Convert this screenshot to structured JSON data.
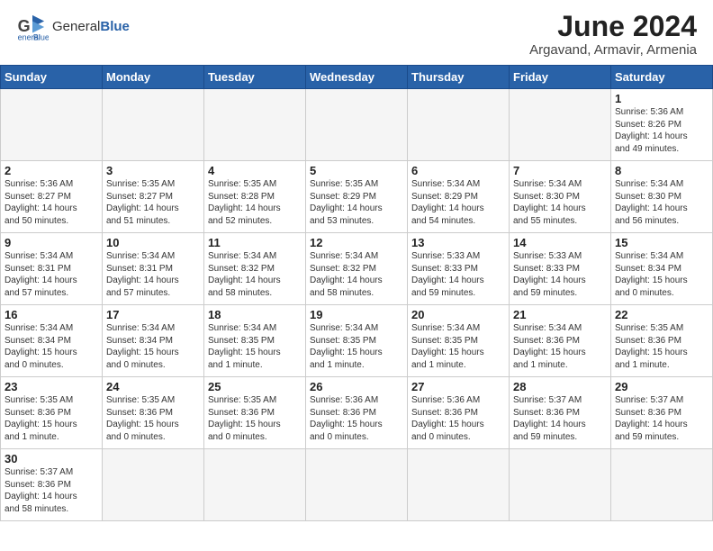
{
  "header": {
    "logo_general": "General",
    "logo_blue": "Blue",
    "month": "June 2024",
    "location": "Argavand, Armavir, Armenia"
  },
  "weekdays": [
    "Sunday",
    "Monday",
    "Tuesday",
    "Wednesday",
    "Thursday",
    "Friday",
    "Saturday"
  ],
  "weeks": [
    [
      {
        "day": "",
        "info": ""
      },
      {
        "day": "",
        "info": ""
      },
      {
        "day": "",
        "info": ""
      },
      {
        "day": "",
        "info": ""
      },
      {
        "day": "",
        "info": ""
      },
      {
        "day": "",
        "info": ""
      },
      {
        "day": "1",
        "info": "Sunrise: 5:36 AM\nSunset: 8:26 PM\nDaylight: 14 hours\nand 49 minutes."
      }
    ],
    [
      {
        "day": "2",
        "info": "Sunrise: 5:36 AM\nSunset: 8:27 PM\nDaylight: 14 hours\nand 50 minutes."
      },
      {
        "day": "3",
        "info": "Sunrise: 5:35 AM\nSunset: 8:27 PM\nDaylight: 14 hours\nand 51 minutes."
      },
      {
        "day": "4",
        "info": "Sunrise: 5:35 AM\nSunset: 8:28 PM\nDaylight: 14 hours\nand 52 minutes."
      },
      {
        "day": "5",
        "info": "Sunrise: 5:35 AM\nSunset: 8:29 PM\nDaylight: 14 hours\nand 53 minutes."
      },
      {
        "day": "6",
        "info": "Sunrise: 5:34 AM\nSunset: 8:29 PM\nDaylight: 14 hours\nand 54 minutes."
      },
      {
        "day": "7",
        "info": "Sunrise: 5:34 AM\nSunset: 8:30 PM\nDaylight: 14 hours\nand 55 minutes."
      },
      {
        "day": "8",
        "info": "Sunrise: 5:34 AM\nSunset: 8:30 PM\nDaylight: 14 hours\nand 56 minutes."
      }
    ],
    [
      {
        "day": "9",
        "info": "Sunrise: 5:34 AM\nSunset: 8:31 PM\nDaylight: 14 hours\nand 57 minutes."
      },
      {
        "day": "10",
        "info": "Sunrise: 5:34 AM\nSunset: 8:31 PM\nDaylight: 14 hours\nand 57 minutes."
      },
      {
        "day": "11",
        "info": "Sunrise: 5:34 AM\nSunset: 8:32 PM\nDaylight: 14 hours\nand 58 minutes."
      },
      {
        "day": "12",
        "info": "Sunrise: 5:34 AM\nSunset: 8:32 PM\nDaylight: 14 hours\nand 58 minutes."
      },
      {
        "day": "13",
        "info": "Sunrise: 5:33 AM\nSunset: 8:33 PM\nDaylight: 14 hours\nand 59 minutes."
      },
      {
        "day": "14",
        "info": "Sunrise: 5:33 AM\nSunset: 8:33 PM\nDaylight: 14 hours\nand 59 minutes."
      },
      {
        "day": "15",
        "info": "Sunrise: 5:34 AM\nSunset: 8:34 PM\nDaylight: 15 hours\nand 0 minutes."
      }
    ],
    [
      {
        "day": "16",
        "info": "Sunrise: 5:34 AM\nSunset: 8:34 PM\nDaylight: 15 hours\nand 0 minutes."
      },
      {
        "day": "17",
        "info": "Sunrise: 5:34 AM\nSunset: 8:34 PM\nDaylight: 15 hours\nand 0 minutes."
      },
      {
        "day": "18",
        "info": "Sunrise: 5:34 AM\nSunset: 8:35 PM\nDaylight: 15 hours\nand 1 minute."
      },
      {
        "day": "19",
        "info": "Sunrise: 5:34 AM\nSunset: 8:35 PM\nDaylight: 15 hours\nand 1 minute."
      },
      {
        "day": "20",
        "info": "Sunrise: 5:34 AM\nSunset: 8:35 PM\nDaylight: 15 hours\nand 1 minute."
      },
      {
        "day": "21",
        "info": "Sunrise: 5:34 AM\nSunset: 8:36 PM\nDaylight: 15 hours\nand 1 minute."
      },
      {
        "day": "22",
        "info": "Sunrise: 5:35 AM\nSunset: 8:36 PM\nDaylight: 15 hours\nand 1 minute."
      }
    ],
    [
      {
        "day": "23",
        "info": "Sunrise: 5:35 AM\nSunset: 8:36 PM\nDaylight: 15 hours\nand 1 minute."
      },
      {
        "day": "24",
        "info": "Sunrise: 5:35 AM\nSunset: 8:36 PM\nDaylight: 15 hours\nand 0 minutes."
      },
      {
        "day": "25",
        "info": "Sunrise: 5:35 AM\nSunset: 8:36 PM\nDaylight: 15 hours\nand 0 minutes."
      },
      {
        "day": "26",
        "info": "Sunrise: 5:36 AM\nSunset: 8:36 PM\nDaylight: 15 hours\nand 0 minutes."
      },
      {
        "day": "27",
        "info": "Sunrise: 5:36 AM\nSunset: 8:36 PM\nDaylight: 15 hours\nand 0 minutes."
      },
      {
        "day": "28",
        "info": "Sunrise: 5:37 AM\nSunset: 8:36 PM\nDaylight: 14 hours\nand 59 minutes."
      },
      {
        "day": "29",
        "info": "Sunrise: 5:37 AM\nSunset: 8:36 PM\nDaylight: 14 hours\nand 59 minutes."
      }
    ],
    [
      {
        "day": "30",
        "info": "Sunrise: 5:37 AM\nSunset: 8:36 PM\nDaylight: 14 hours\nand 58 minutes."
      },
      {
        "day": "",
        "info": ""
      },
      {
        "day": "",
        "info": ""
      },
      {
        "day": "",
        "info": ""
      },
      {
        "day": "",
        "info": ""
      },
      {
        "day": "",
        "info": ""
      },
      {
        "day": "",
        "info": ""
      }
    ]
  ]
}
